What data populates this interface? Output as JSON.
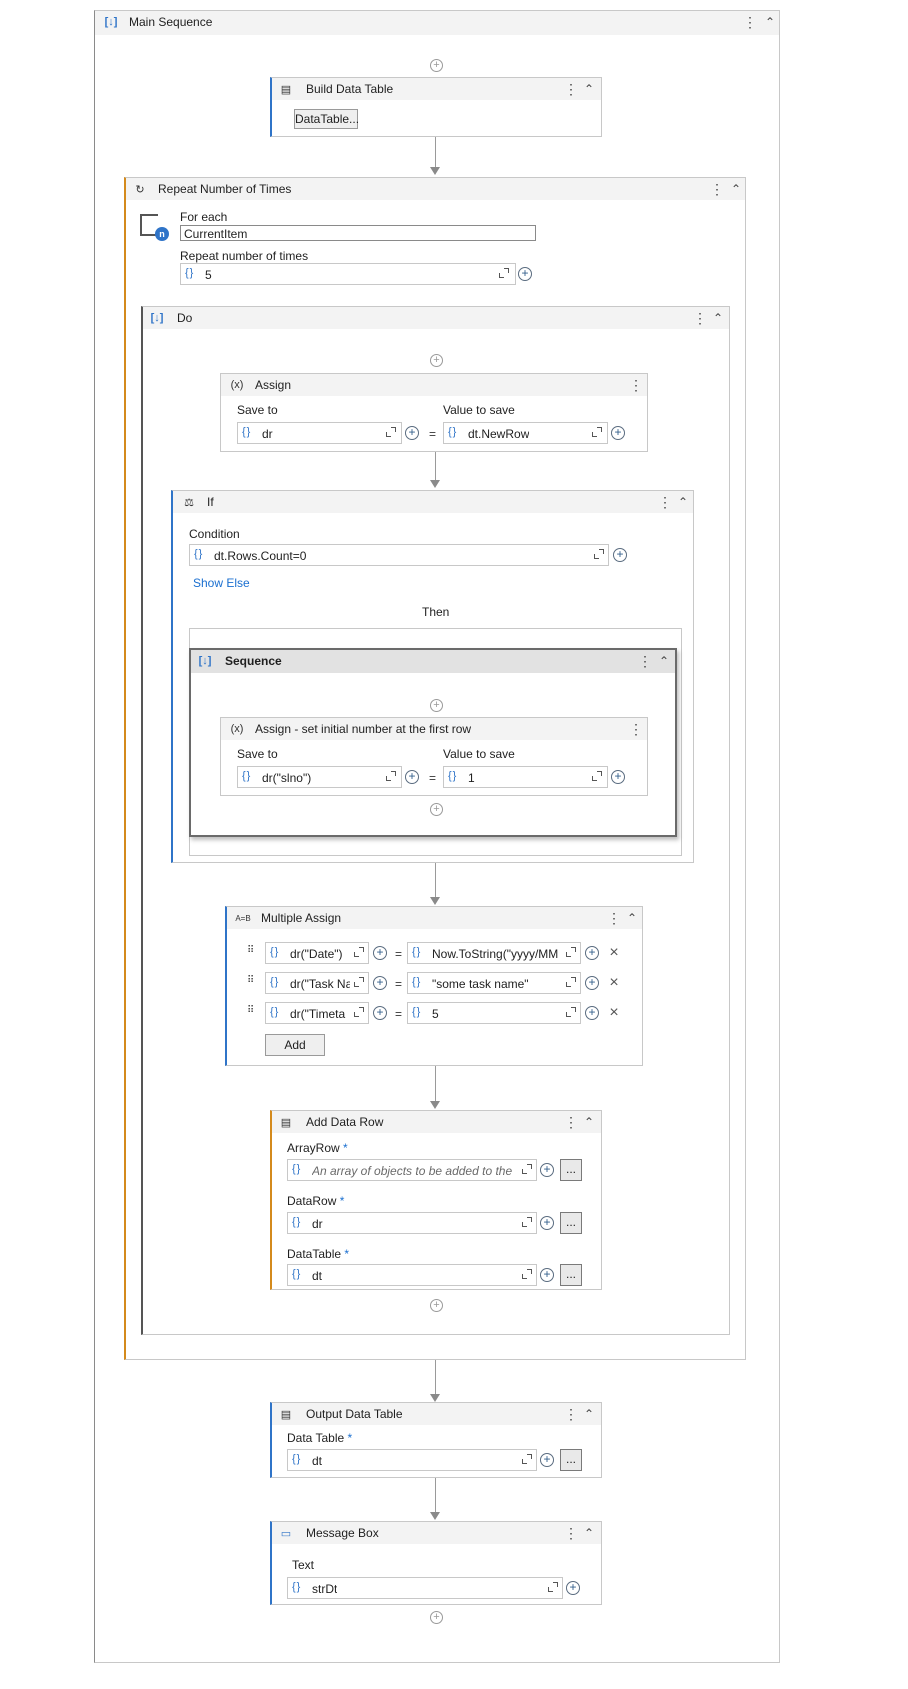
{
  "main_sequence": {
    "title": "Main Sequence",
    "icon": "sequence-icon"
  },
  "build_data_table": {
    "title": "Build Data Table",
    "button": "DataTable..."
  },
  "repeat": {
    "title": "Repeat Number of Times",
    "for_each_label": "For each",
    "for_each_value": "CurrentItem",
    "times_label": "Repeat number of times",
    "times_value": "5"
  },
  "do_seq": {
    "title": "Do"
  },
  "assign1": {
    "title": "Assign",
    "save_to_label": "Save to",
    "value_label": "Value to save",
    "save_to": "dr",
    "value": "dt.NewRow"
  },
  "if_block": {
    "title": "If",
    "condition_label": "Condition",
    "condition": "dt.Rows.Count=0",
    "show_else": "Show Else",
    "then_label": "Then"
  },
  "inner_seq": {
    "title": "Sequence"
  },
  "assign2": {
    "title": "Assign - set initial number at the first row",
    "save_to_label": "Save to",
    "value_label": "Value to save",
    "save_to": "dr(\"slno\")",
    "value": "1"
  },
  "multi_assign": {
    "title": "Multiple Assign",
    "rows": [
      {
        "left": "dr(\"Date\")",
        "right": "Now.ToString(\"yyyy/MM"
      },
      {
        "left": "dr(\"Task Na",
        "right": "\"some task name\""
      },
      {
        "left": "dr(\"Timeta",
        "right": "5"
      }
    ],
    "add_button": "Add"
  },
  "add_data_row": {
    "title": "Add Data Row",
    "array_row_label": "ArrayRow",
    "array_row_placeholder": "An array of objects to be added to the",
    "data_row_label": "DataRow",
    "data_row_value": "dr",
    "data_table_label": "DataTable",
    "data_table_value": "dt",
    "required_mark": "*",
    "ellipsis": "..."
  },
  "output_dt": {
    "title": "Output Data Table",
    "data_table_label": "Data Table",
    "value": "dt",
    "required_mark": "*",
    "ellipsis": "..."
  },
  "message_box": {
    "title": "Message Box",
    "text_label": "Text",
    "value": "strDt"
  },
  "glyphs": {
    "braces": "{}",
    "equals": "=",
    "plus": "+",
    "kebab": "⋮",
    "collapse": "⌃",
    "close": "×"
  }
}
